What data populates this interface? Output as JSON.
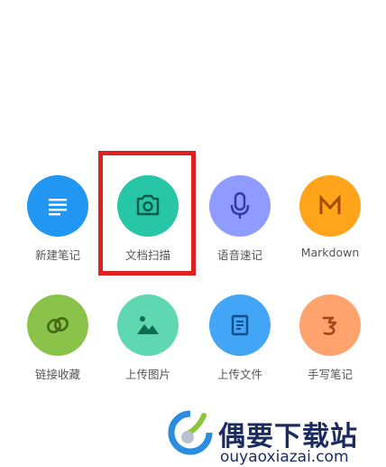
{
  "actions": [
    {
      "label": "新建笔记",
      "icon": "note-lines-icon",
      "color": "#2196F3"
    },
    {
      "label": "文档扫描",
      "icon": "camera-icon",
      "color": "#26C6A6"
    },
    {
      "label": "语音速记",
      "icon": "microphone-icon",
      "color": "#8F9BFF"
    },
    {
      "label": "Markdown",
      "icon": "markdown-m-icon",
      "color": "#FFA41B"
    },
    {
      "label": "链接收藏",
      "icon": "link-icon",
      "color": "#8BC34A"
    },
    {
      "label": "上传图片",
      "icon": "image-icon",
      "color": "#5FD7B0"
    },
    {
      "label": "上传文件",
      "icon": "file-icon",
      "color": "#42A5F5"
    },
    {
      "label": "手写笔记",
      "icon": "handwriting-icon",
      "color": "#FFA36E"
    }
  ],
  "highlight_color": "#e02020",
  "watermark": {
    "title": "偶要下载站",
    "url": "ouyaoxiazai.com"
  }
}
